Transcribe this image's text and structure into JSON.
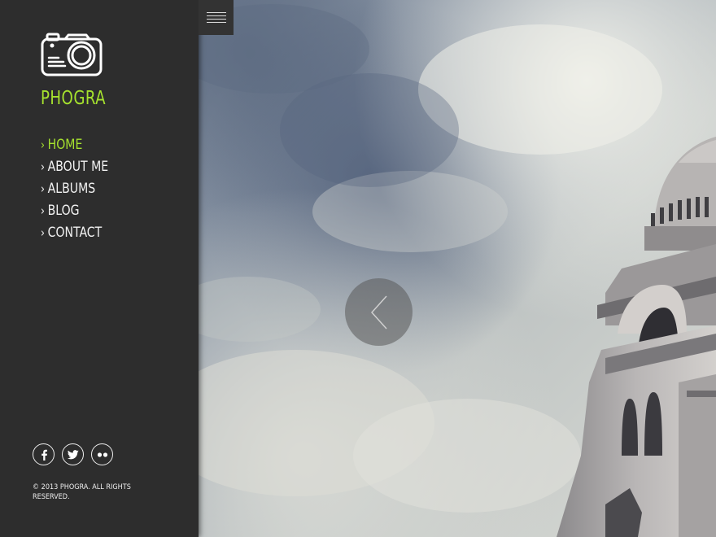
{
  "brand": {
    "name": "PHOGRA"
  },
  "nav": {
    "items": [
      {
        "label": "HOME",
        "active": true
      },
      {
        "label": "ABOUT ME",
        "active": false
      },
      {
        "label": "ALBUMS",
        "active": false
      },
      {
        "label": "BLOG",
        "active": false
      },
      {
        "label": "CONTACT",
        "active": false
      }
    ]
  },
  "social": {
    "icons": [
      "facebook-icon",
      "twitter-icon",
      "flickr-icon"
    ]
  },
  "footer": {
    "copyright": "© 2013 PHOGRA. ALL RIGHTS RESERVED."
  },
  "colors": {
    "accent": "#a6e22e",
    "sidebar": "#2d2d2d"
  },
  "slider": {
    "prev_icon": "chevron-left-icon"
  },
  "menu": {
    "icon": "hamburger-icon"
  }
}
